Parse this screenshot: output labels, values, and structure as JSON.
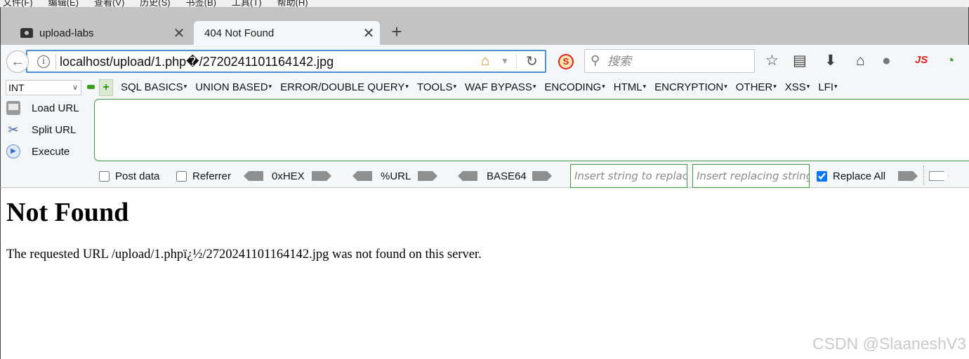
{
  "menubar": {
    "items": [
      "文件(F)",
      "编辑(E)",
      "查看(V)",
      "历史(S)",
      "书签(B)",
      "工具(T)",
      "帮助(H)"
    ]
  },
  "tabs": [
    {
      "label": "upload-labs",
      "active": false
    },
    {
      "label": "404 Not Found",
      "active": true
    }
  ],
  "navbar": {
    "url": "localhost/upload/1.php�/2720241101164142.jpg",
    "search_placeholder": "搜索",
    "js_label": "JS"
  },
  "hackbar": {
    "type_select": "INT",
    "menus": [
      "SQL BASICS",
      "UNION BASED",
      "ERROR/DOUBLE QUERY",
      "TOOLS",
      "WAF BYPASS",
      "ENCODING",
      "HTML",
      "ENCRYPTION",
      "OTHER",
      "XSS",
      "LFI"
    ],
    "load_url": "Load URL",
    "split_url": "Split URL",
    "execute": "Execute",
    "post_data": "Post data",
    "referrer": "Referrer",
    "hex": "0xHEX",
    "urlenc": "%URL",
    "base64": "BASE64",
    "replace_placeholder": "Insert string to replace",
    "replacing_placeholder": "Insert replacing string",
    "replace_all": "Replace All",
    "replace_all_checked": true
  },
  "page": {
    "heading": "Not Found",
    "message": "The requested URL /upload/1.phpï¿½/2720241101164142.jpg was not found on this server."
  },
  "watermark": "CSDN @SlaaneshV3"
}
